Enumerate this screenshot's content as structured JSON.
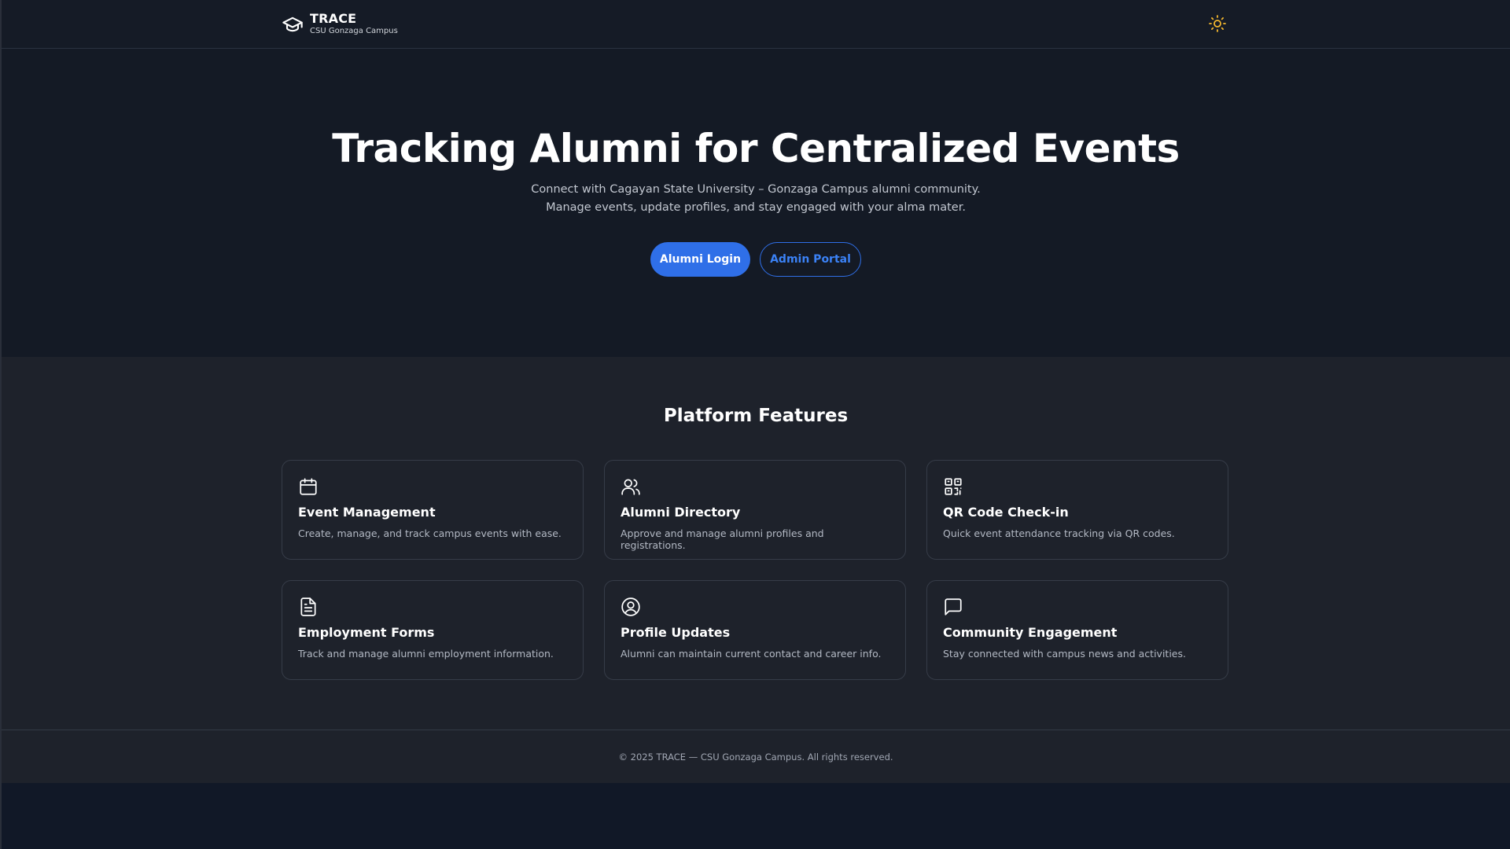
{
  "header": {
    "title": "TRACE",
    "subtitle": "CSU Gonzaga Campus",
    "logo_icon": "graduation-cap-icon",
    "theme_toggle_icon": "sun-icon"
  },
  "hero": {
    "title": "Tracking Alumni for Centralized Events",
    "description_line1": "Connect with Cagayan State University – Gonzaga Campus alumni community.",
    "description_line2": "Manage events, update profiles, and stay engaged with your alma mater.",
    "primary_button": "Alumni Login",
    "secondary_button": "Admin Portal"
  },
  "features": {
    "title": "Platform Features",
    "items": [
      {
        "icon": "calendar-icon",
        "title": "Event Management",
        "description": "Create, manage, and track campus events with ease."
      },
      {
        "icon": "users-icon",
        "title": "Alumni Directory",
        "description": "Approve and manage alumni profiles and registrations."
      },
      {
        "icon": "qr-code-icon",
        "title": "QR Code Check-in",
        "description": "Quick event attendance tracking via QR codes."
      },
      {
        "icon": "document-icon",
        "title": "Employment Forms",
        "description": "Track and manage alumni employment information."
      },
      {
        "icon": "user-circle-icon",
        "title": "Profile Updates",
        "description": "Alumni can maintain current contact and career info."
      },
      {
        "icon": "message-square-icon",
        "title": "Community Engagement",
        "description": "Stay connected with campus news and activities."
      }
    ]
  },
  "footer": {
    "text": "© 2025 TRACE — CSU Gonzaga Campus. All rights reserved."
  },
  "colors": {
    "accent": "#2f6fe8",
    "sun": "#f5b82e",
    "background": "#111827"
  }
}
